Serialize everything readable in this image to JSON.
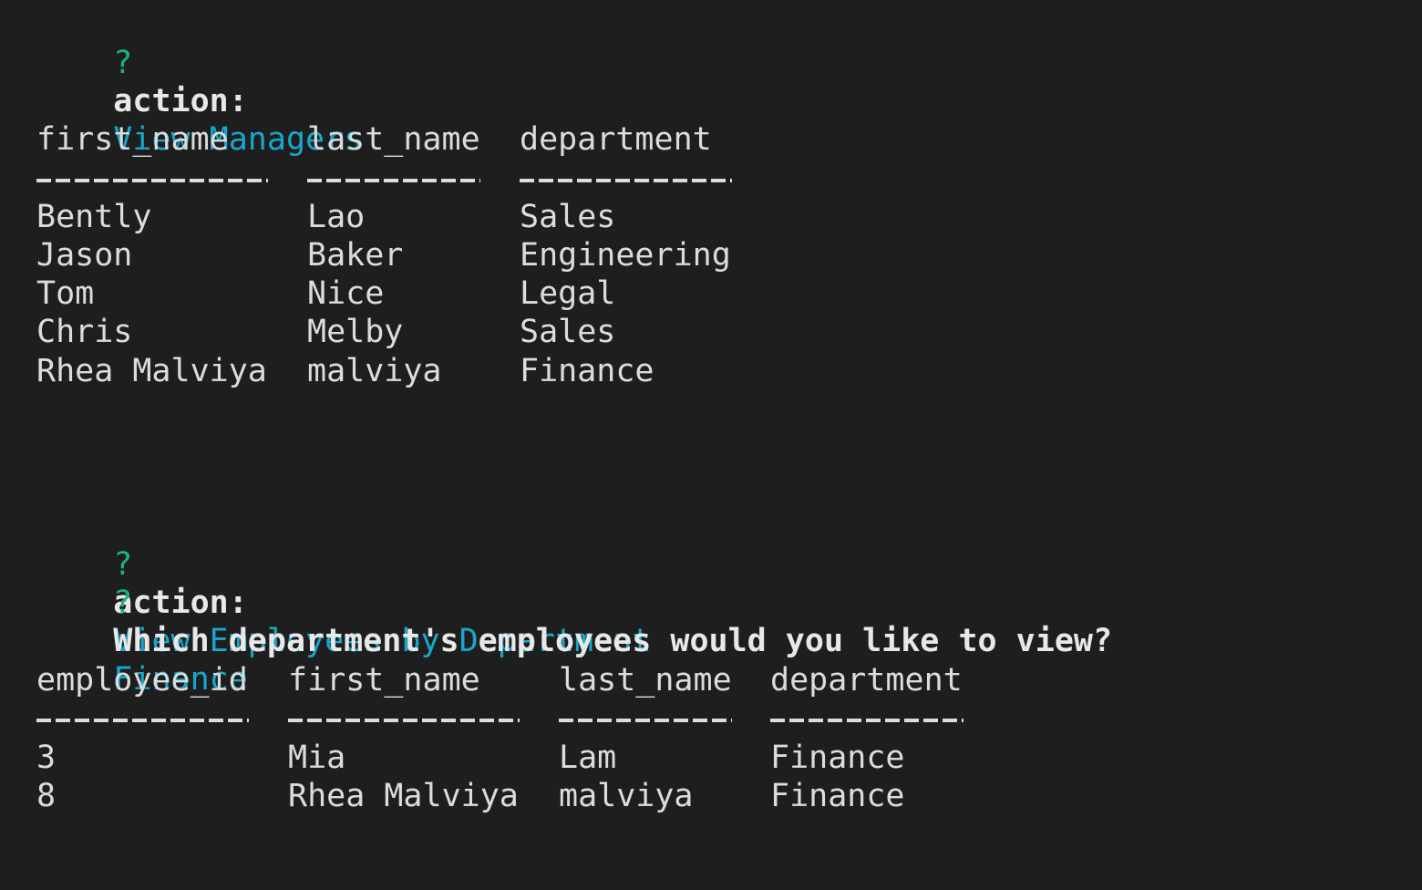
{
  "prompt_marker": "?",
  "block1": {
    "action_label": "action:",
    "action_value": "View Managers",
    "table": {
      "columns": [
        "first_name",
        "last_name",
        "department"
      ],
      "rows": [
        [
          "Bently",
          "Lao",
          "Sales"
        ],
        [
          "Jason",
          "Baker",
          "Engineering"
        ],
        [
          "Tom",
          "Nice",
          "Legal"
        ],
        [
          "Chris",
          "Melby",
          "Sales"
        ],
        [
          "Rhea Malviya",
          "malviya",
          "Finance"
        ]
      ]
    }
  },
  "block2": {
    "action_label": "action:",
    "action_value": "View Employees by Department",
    "question_label": "Which department's employees would you like to view?",
    "question_answer": "Finance",
    "table": {
      "columns": [
        "employee_id",
        "first_name",
        "last_name",
        "department"
      ],
      "rows": [
        [
          "3",
          "Mia",
          "Lam",
          "Finance"
        ],
        [
          "8",
          "Rhea Malviya",
          "malviya",
          "Finance"
        ]
      ]
    }
  },
  "colors": {
    "background": "#1e1e1e",
    "prompt_marker": "#1bb37a",
    "answer": "#16a8cc",
    "text": "#dcdcdc"
  }
}
